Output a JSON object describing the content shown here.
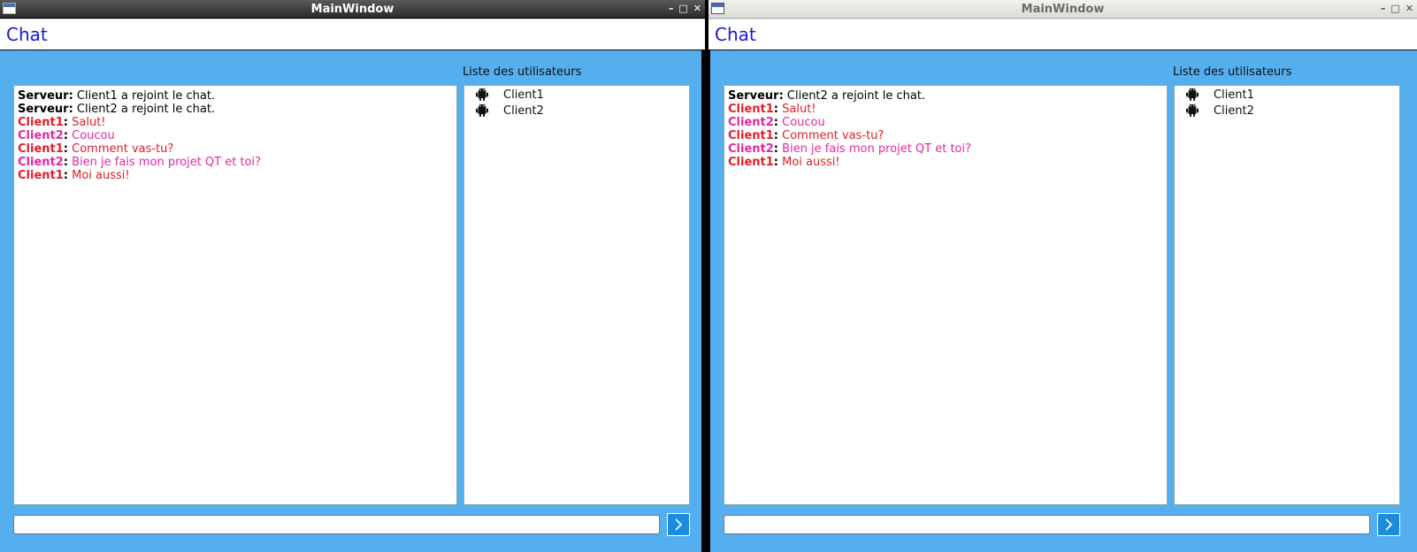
{
  "windows": [
    {
      "title": "MainWindow",
      "window_buttons": {
        "minimize": "–",
        "maximize": "□",
        "close": "✕"
      },
      "header_title": "Chat",
      "users_label": "Liste des utilisateurs",
      "messages": [
        {
          "sender": "Serveur",
          "text": " Client1 a rejoint le chat."
        },
        {
          "sender": "Serveur",
          "text": " Client2 a rejoint le chat."
        },
        {
          "sender": "Client1",
          "text": " Salut!"
        },
        {
          "sender": "Client2",
          "text": " Coucou"
        },
        {
          "sender": "Client1",
          "text": " Comment vas-tu?"
        },
        {
          "sender": "Client2",
          "text": " Bien je fais mon projet QT et toi?"
        },
        {
          "sender": "Client1",
          "text": " Moi aussi!"
        }
      ],
      "users": [
        "Client1",
        "Client2"
      ],
      "input_value": "",
      "send_icon": "chevron-right-icon"
    },
    {
      "title": "MainWindow",
      "window_buttons": {
        "minimize": "–",
        "maximize": "□",
        "close": "✕"
      },
      "header_title": "Chat",
      "users_label": "Liste des utilisateurs",
      "messages": [
        {
          "sender": "Serveur",
          "text": " Client2 a rejoint le chat."
        },
        {
          "sender": "Client1",
          "text": " Salut!"
        },
        {
          "sender": "Client2",
          "text": " Coucou"
        },
        {
          "sender": "Client1",
          "text": " Comment vas-tu?"
        },
        {
          "sender": "Client2",
          "text": " Bien je fais mon projet QT et toi?"
        },
        {
          "sender": "Client1",
          "text": " Moi aussi!"
        }
      ],
      "users": [
        "Client1",
        "Client2"
      ],
      "input_value": "",
      "send_icon": "chevron-right-icon"
    }
  ],
  "colors": {
    "background": "#55aeee",
    "header_title": "#1a1ad6",
    "serveur": "#000000",
    "client1": "#e0202a",
    "client2": "#e02aa0",
    "send_button": "#1a8ddd"
  }
}
